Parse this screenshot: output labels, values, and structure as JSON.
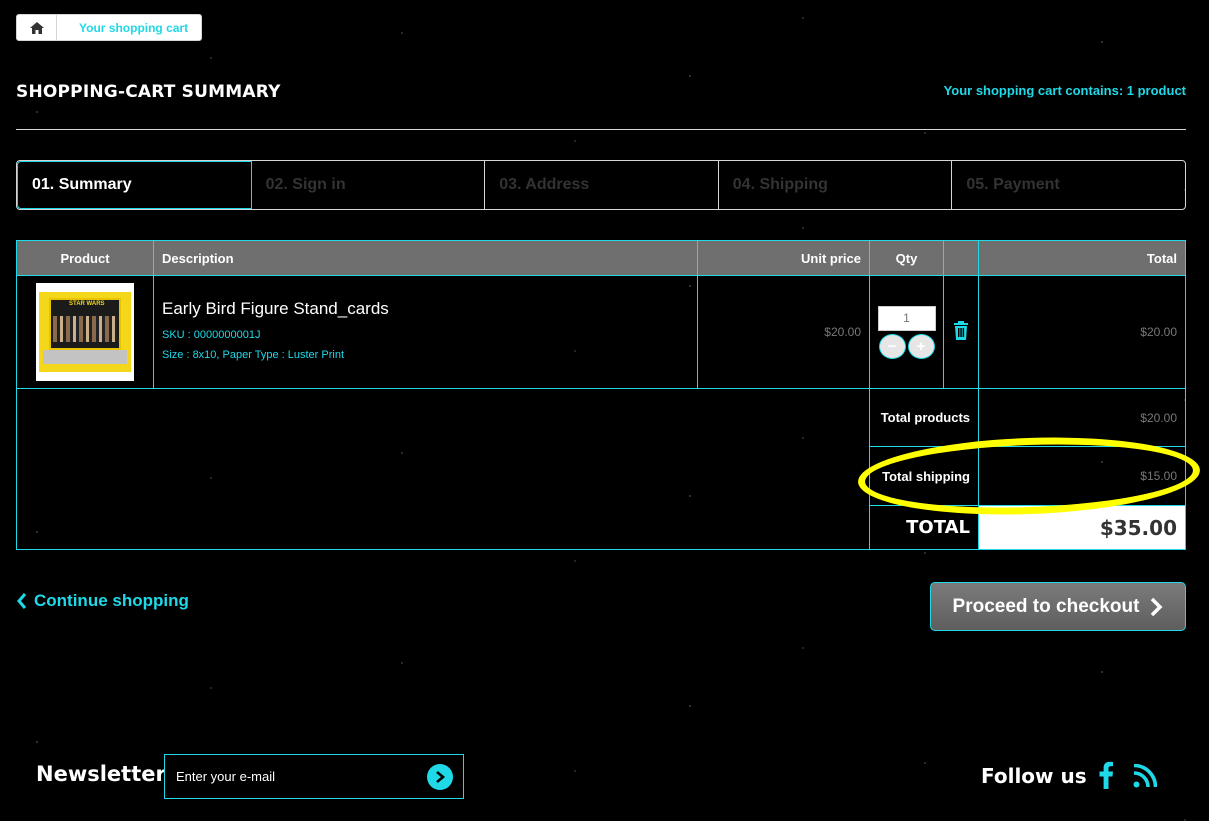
{
  "breadcrumb": {
    "home_icon": "home-icon",
    "current": "Your shopping cart"
  },
  "heading": {
    "title": "SHOPPING-CART SUMMARY",
    "cart_count": "Your shopping cart contains: 1 product"
  },
  "steps": [
    "01. Summary",
    "02. Sign in",
    "03. Address",
    "04. Shipping",
    "05. Payment"
  ],
  "table": {
    "headers": {
      "product": "Product",
      "description": "Description",
      "unit_price": "Unit price",
      "qty": "Qty",
      "total": "Total"
    },
    "item": {
      "name": "Early Bird Figure Stand_cards",
      "sku": "SKU : 0000000001J",
      "options": "Size : 8x10, Paper Type : Luster Print",
      "unit_price": "$20.00",
      "qty": "1",
      "total": "$20.00",
      "thumb_logo": "STAR WARS"
    },
    "summary": {
      "total_products_label": "Total products",
      "total_products": "$20.00",
      "total_shipping_label": "Total shipping",
      "total_shipping": "$15.00",
      "total_label": "TOTAL",
      "total": "$35.00"
    }
  },
  "actions": {
    "continue": "Continue shopping",
    "checkout": "Proceed to checkout"
  },
  "footer": {
    "newsletter_title": "Newsletter",
    "newsletter_placeholder": "Enter your e-mail",
    "follow_title": "Follow us"
  },
  "colors": {
    "accent": "#1fd9e8",
    "highlight": "#ffff00",
    "header_bg": "#6f6f6f",
    "background": "#000000"
  }
}
